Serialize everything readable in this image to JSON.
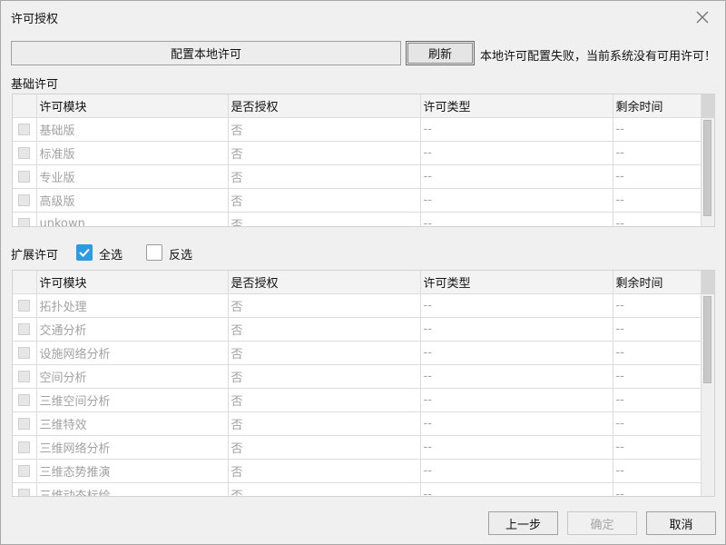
{
  "dialog": {
    "title": "许可授权",
    "close_icon": "close-icon"
  },
  "top_bar": {
    "configure_local_label": "配置本地许可",
    "refresh_label": "刷新",
    "message": "本地许可配置失败，当前系统没有可用许可！"
  },
  "basic": {
    "label": "基础许可",
    "columns": [
      "许可模块",
      "是否授权",
      "许可类型",
      "剩余时间"
    ],
    "rows": [
      {
        "module": "基础版",
        "authorized": "否",
        "type": "--",
        "remaining": "--"
      },
      {
        "module": "标准版",
        "authorized": "否",
        "type": "--",
        "remaining": "--"
      },
      {
        "module": "专业版",
        "authorized": "否",
        "type": "--",
        "remaining": "--"
      },
      {
        "module": "高级版",
        "authorized": "否",
        "type": "--",
        "remaining": "--"
      },
      {
        "module": "unkown",
        "authorized": "否",
        "type": "--",
        "remaining": "--"
      }
    ]
  },
  "extended": {
    "label": "扩展许可",
    "select_all_label": "全选",
    "select_all_checked": true,
    "invert_label": "反选",
    "invert_checked": false,
    "columns": [
      "许可模块",
      "是否授权",
      "许可类型",
      "剩余时间"
    ],
    "rows": [
      {
        "module": "拓扑处理",
        "authorized": "否",
        "type": "--",
        "remaining": "--"
      },
      {
        "module": "交通分析",
        "authorized": "否",
        "type": "--",
        "remaining": "--"
      },
      {
        "module": "设施网络分析",
        "authorized": "否",
        "type": "--",
        "remaining": "--"
      },
      {
        "module": "空间分析",
        "authorized": "否",
        "type": "--",
        "remaining": "--"
      },
      {
        "module": "三维空间分析",
        "authorized": "否",
        "type": "--",
        "remaining": "--"
      },
      {
        "module": "三维特效",
        "authorized": "否",
        "type": "--",
        "remaining": "--"
      },
      {
        "module": "三维网络分析",
        "authorized": "否",
        "type": "--",
        "remaining": "--"
      },
      {
        "module": "三维态势推演",
        "authorized": "否",
        "type": "--",
        "remaining": "--"
      },
      {
        "module": "三维动态标绘",
        "authorized": "否",
        "type": "--",
        "remaining": "--"
      }
    ]
  },
  "footer": {
    "prev_label": "上一步",
    "ok_label": "确定",
    "cancel_label": "取消"
  },
  "colors": {
    "accent": "#2d9be0",
    "disabled_text": "#a2a2a2"
  }
}
